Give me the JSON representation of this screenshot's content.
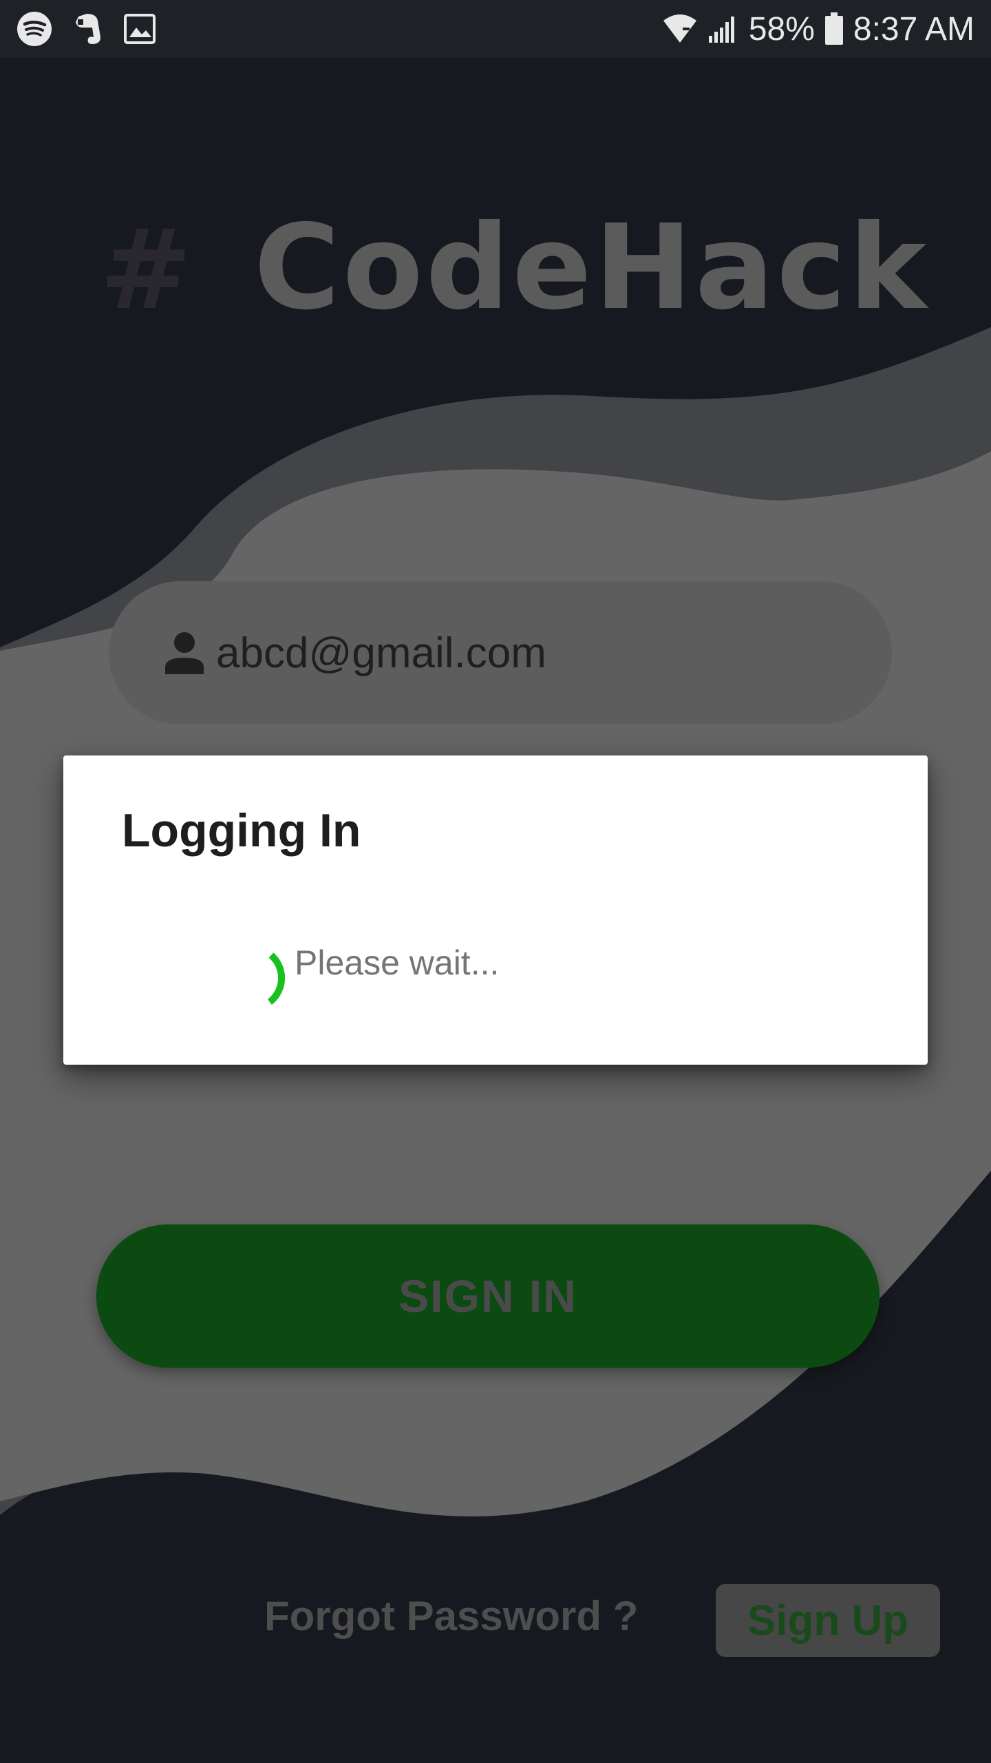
{
  "status_bar": {
    "left_icons": [
      "spotify-icon",
      "evernote-icon",
      "gallery-icon"
    ],
    "right_icons": [
      "wifi-icon",
      "signal-icon",
      "battery-icon"
    ],
    "battery": "58%",
    "time": "8:37 AM"
  },
  "brand": {
    "hash": "#",
    "name": "CodeHack"
  },
  "email_field": {
    "icon": "person-icon",
    "value": "abcd@gmail.com"
  },
  "sign_in_button": {
    "label": "SIGN IN"
  },
  "forgot_password": {
    "label": "Forgot Password ?"
  },
  "sign_up_button": {
    "label": "Sign Up"
  },
  "dialog": {
    "title": "Logging In",
    "message": "Please wait...",
    "spinner_icon": "loading-spinner-icon"
  },
  "colors": {
    "background": "#16191f",
    "wave_mid": "#434447",
    "wave_light": "#656565",
    "accent_green": "#0b4a10",
    "spinner_green": "#18c21e",
    "dialog_bg": "#ffffff"
  }
}
